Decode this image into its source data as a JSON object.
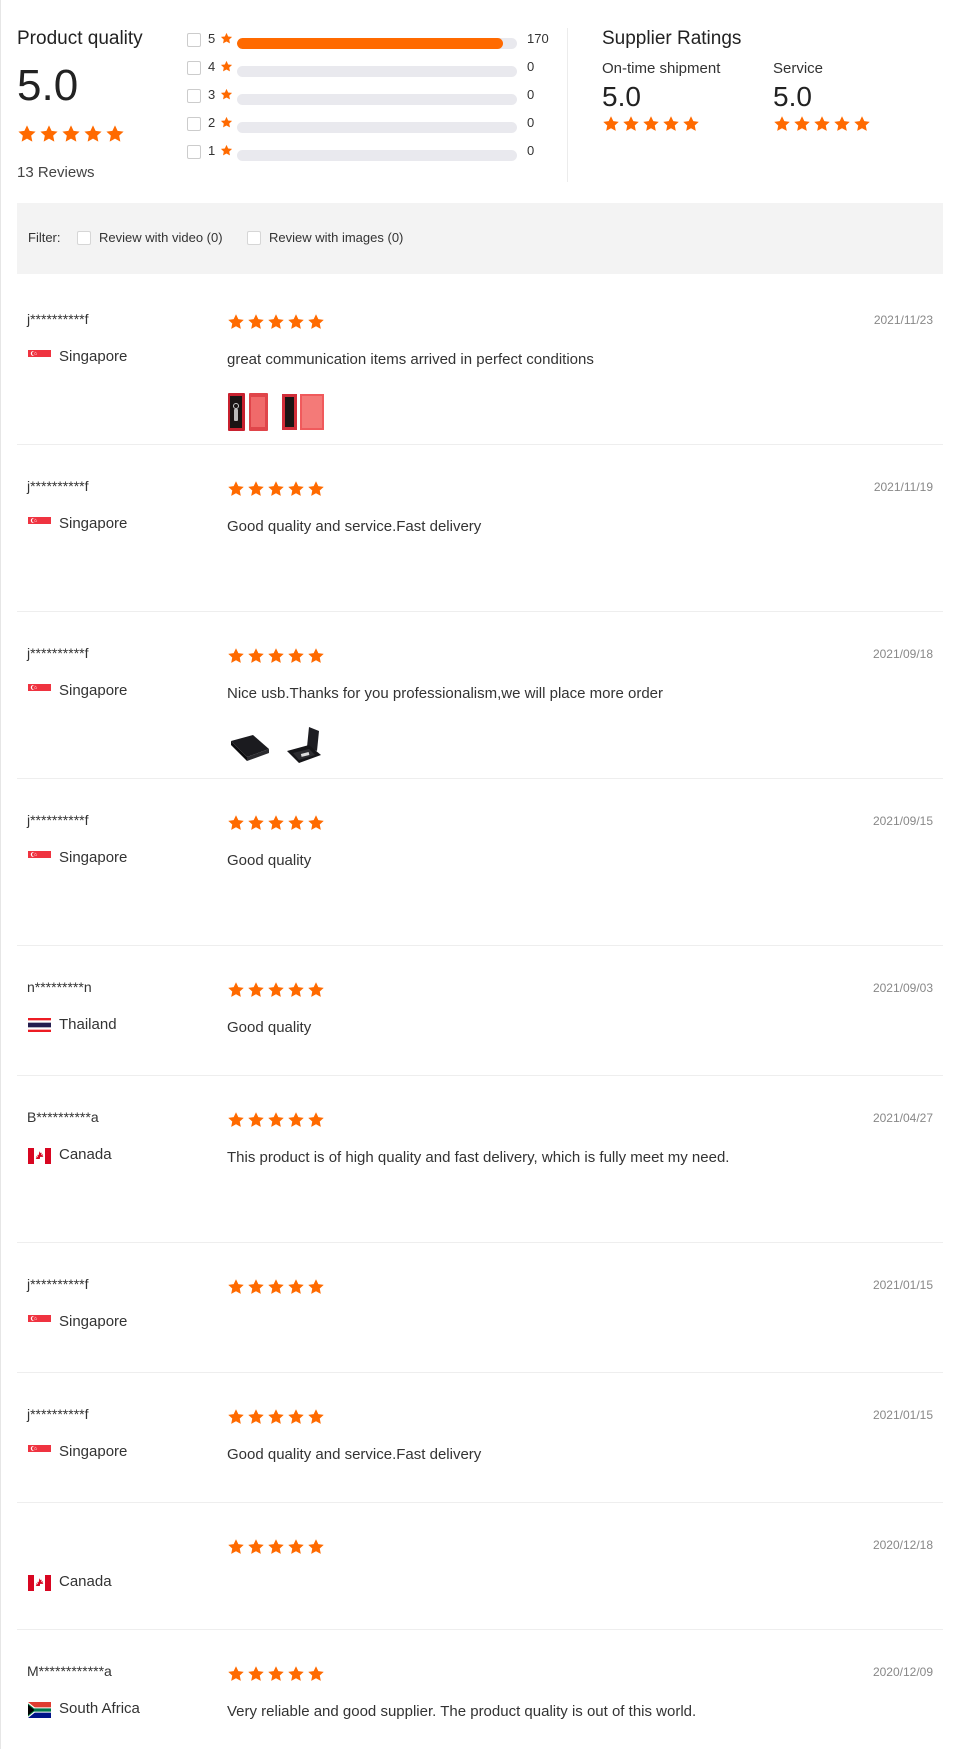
{
  "accent_color": "#ff6a00",
  "product_quality": {
    "title": "Product quality",
    "score": "5.0",
    "stars": 5,
    "reviews_label": "13 Reviews"
  },
  "distribution": [
    {
      "label": "5",
      "count": "170",
      "fraction": 0.95
    },
    {
      "label": "4",
      "count": "0",
      "fraction": 0
    },
    {
      "label": "3",
      "count": "0",
      "fraction": 0
    },
    {
      "label": "2",
      "count": "0",
      "fraction": 0
    },
    {
      "label": "1",
      "count": "0",
      "fraction": 0
    }
  ],
  "supplier_ratings": {
    "title": "Supplier Ratings",
    "shipment": {
      "label": "On-time shipment",
      "score": "5.0",
      "stars": 5
    },
    "service": {
      "label": "Service",
      "score": "5.0",
      "stars": 5
    }
  },
  "filter": {
    "label": "Filter:",
    "video_label": "Review with video (0)",
    "images_label": "Review with images (0)"
  },
  "reviews": [
    {
      "name": "j**********f",
      "flag": "singapore-flag-icon",
      "country": "Singapore",
      "stars": 5,
      "date": "2021/11/23",
      "text": "great communication items arrived in perfect conditions",
      "images": [
        "red-gift-box-open-thumbnail",
        "red-gift-box-closed-thumbnail"
      ]
    },
    {
      "name": "j**********f",
      "flag": "singapore-flag-icon",
      "country": "Singapore",
      "stars": 5,
      "date": "2021/11/19",
      "text": "Good quality and service.Fast delivery",
      "images": []
    },
    {
      "name": "j**********f",
      "flag": "singapore-flag-icon",
      "country": "Singapore",
      "stars": 5,
      "date": "2021/09/18",
      "text": "Nice usb.Thanks for you professionalism,we will place more order",
      "images": [
        "black-box-closed-thumbnail",
        "black-box-open-usb-thumbnail"
      ]
    },
    {
      "name": "j**********f",
      "flag": "singapore-flag-icon",
      "country": "Singapore",
      "stars": 5,
      "date": "2021/09/15",
      "text": "Good quality",
      "images": []
    },
    {
      "name": "n*********n",
      "flag": "thailand-flag-icon",
      "country": "Thailand",
      "stars": 5,
      "date": "2021/09/03",
      "text": "Good quality",
      "images": []
    },
    {
      "name": "B**********a",
      "flag": "canada-flag-icon",
      "country": "Canada",
      "stars": 5,
      "date": "2021/04/27",
      "text": "This product is of high quality and fast delivery, which is fully meet my need.",
      "images": []
    },
    {
      "name": "j**********f",
      "flag": "singapore-flag-icon",
      "country": "Singapore",
      "stars": 5,
      "date": "2021/01/15",
      "text": "",
      "images": []
    },
    {
      "name": "j**********f",
      "flag": "singapore-flag-icon",
      "country": "Singapore",
      "stars": 5,
      "date": "2021/01/15",
      "text": "Good quality and service.Fast delivery",
      "images": []
    },
    {
      "name": "",
      "flag": "canada-flag-icon",
      "country": "Canada",
      "stars": 5,
      "date": "2020/12/18",
      "text": "",
      "images": []
    },
    {
      "name": "M************a",
      "flag": "south-africa-flag-icon",
      "country": "South Africa",
      "stars": 5,
      "date": "2020/12/09",
      "text": "Very reliable and good supplier. The product quality is out of this world.",
      "images": []
    }
  ]
}
